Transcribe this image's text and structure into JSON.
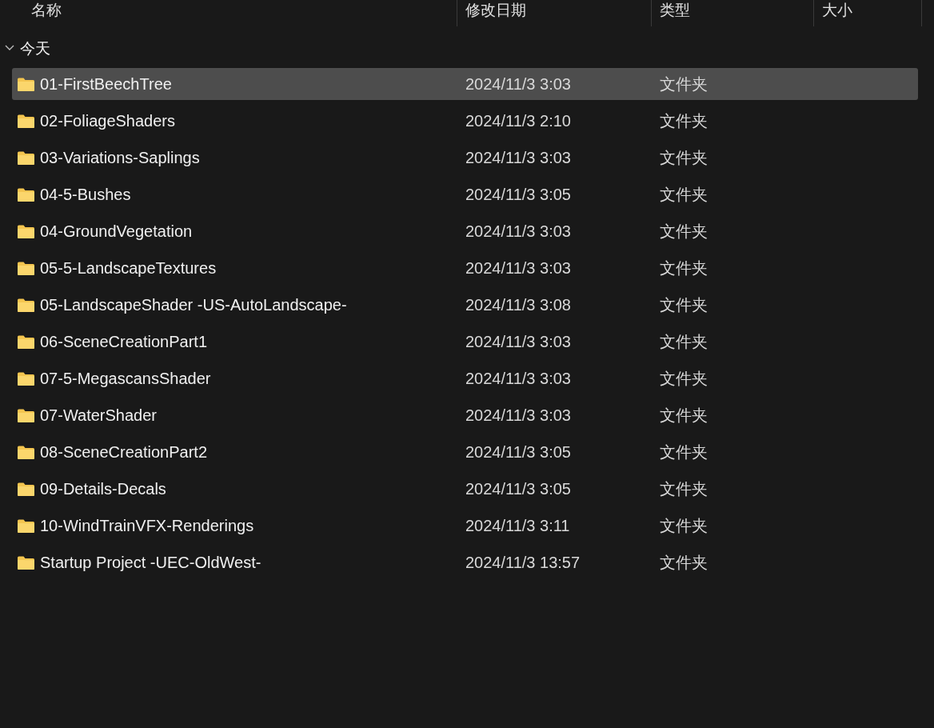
{
  "columns": [
    "名称",
    "修改日期",
    "类型",
    "大小"
  ],
  "group": {
    "label": "今天",
    "expanded": true
  },
  "rows": [
    {
      "name": "01-FirstBeechTree",
      "date": "2024/11/3 3:03",
      "type": "文件夹",
      "selected": true
    },
    {
      "name": "02-FoliageShaders",
      "date": "2024/11/3 2:10",
      "type": "文件夹",
      "selected": false
    },
    {
      "name": "03-Variations-Saplings",
      "date": "2024/11/3 3:03",
      "type": "文件夹",
      "selected": false
    },
    {
      "name": "04-5-Bushes",
      "date": "2024/11/3 3:05",
      "type": "文件夹",
      "selected": false
    },
    {
      "name": "04-GroundVegetation",
      "date": "2024/11/3 3:03",
      "type": "文件夹",
      "selected": false
    },
    {
      "name": "05-5-LandscapeTextures",
      "date": "2024/11/3 3:03",
      "type": "文件夹",
      "selected": false
    },
    {
      "name": "05-LandscapeShader -US-AutoLandscape-",
      "date": "2024/11/3 3:08",
      "type": "文件夹",
      "selected": false
    },
    {
      "name": "06-SceneCreationPart1",
      "date": "2024/11/3 3:03",
      "type": "文件夹",
      "selected": false
    },
    {
      "name": "07-5-MegascansShader",
      "date": "2024/11/3 3:03",
      "type": "文件夹",
      "selected": false
    },
    {
      "name": "07-WaterShader",
      "date": "2024/11/3 3:03",
      "type": "文件夹",
      "selected": false
    },
    {
      "name": "08-SceneCreationPart2",
      "date": "2024/11/3 3:05",
      "type": "文件夹",
      "selected": false
    },
    {
      "name": "09-Details-Decals",
      "date": "2024/11/3 3:05",
      "type": "文件夹",
      "selected": false
    },
    {
      "name": "10-WindTrainVFX-Renderings",
      "date": "2024/11/3 3:11",
      "type": "文件夹",
      "selected": false
    },
    {
      "name": "Startup Project -UEC-OldWest-",
      "date": "2024/11/3 13:57",
      "type": "文件夹",
      "selected": false
    }
  ]
}
